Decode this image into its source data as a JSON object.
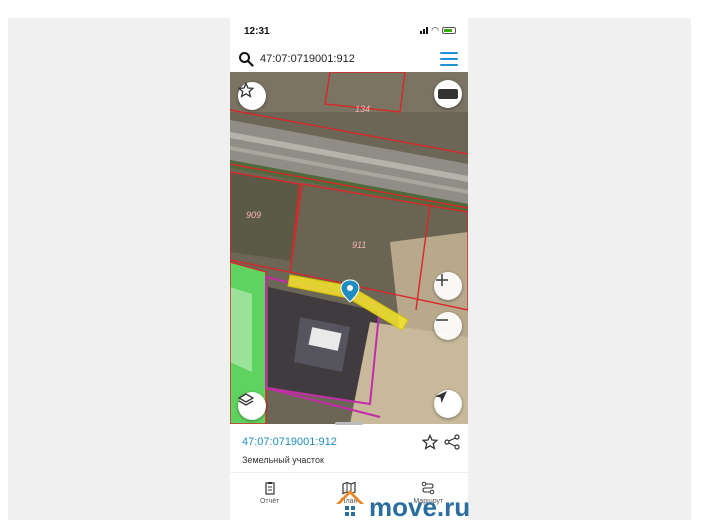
{
  "status_bar": {
    "time": "12:31"
  },
  "search": {
    "query": "47:07:0719001:912"
  },
  "map": {
    "parcel_labels": [
      "134",
      "909",
      "911"
    ],
    "highlight_color": "#f5e62a",
    "boundary_color": "#d62828",
    "marker_color": "#1f8dbf"
  },
  "info_panel": {
    "parcel_id": "47:07:0719001:912",
    "parcel_type": "Земельный участок"
  },
  "tab_bar": {
    "tabs": [
      {
        "label": "Отчёт",
        "icon": "report-icon"
      },
      {
        "label": "План",
        "icon": "map-plan-icon"
      },
      {
        "label": "Маршрут",
        "icon": "route-icon"
      }
    ]
  },
  "watermark": {
    "text": "move.ru"
  }
}
